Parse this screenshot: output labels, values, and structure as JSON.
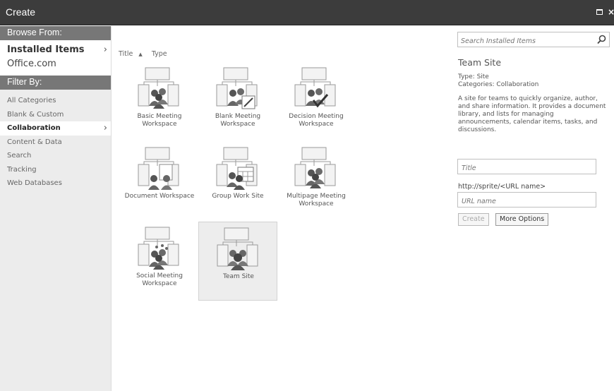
{
  "window": {
    "title": "Create"
  },
  "sidebar": {
    "browse_heading": "Browse From:",
    "browse_items": [
      {
        "label": "Installed Items",
        "selected": true
      },
      {
        "label": "Office.com",
        "selected": false
      }
    ],
    "filter_heading": "Filter By:",
    "filter_items": [
      {
        "label": "All Categories"
      },
      {
        "label": "Blank & Custom"
      },
      {
        "label": "Collaboration",
        "selected": true
      },
      {
        "label": "Content & Data"
      },
      {
        "label": "Search"
      },
      {
        "label": "Tracking"
      },
      {
        "label": "Web Databases"
      }
    ]
  },
  "sort": {
    "title_label": "Title",
    "sort_arrow": "▲",
    "type_label": "Type"
  },
  "templates": [
    {
      "label": "Basic Meeting Workspace",
      "icon": "meeting-people-icon"
    },
    {
      "label": "Blank Meeting Workspace",
      "icon": "meeting-pencil-icon"
    },
    {
      "label": "Decision Meeting Workspace",
      "icon": "meeting-check-icon"
    },
    {
      "label": "Document Workspace",
      "icon": "document-people-icon"
    },
    {
      "label": "Group Work Site",
      "icon": "group-calendar-icon"
    },
    {
      "label": "Multipage Meeting Workspace",
      "icon": "multipage-people-icon"
    },
    {
      "label": "Social Meeting Workspace",
      "icon": "social-people-icon"
    },
    {
      "label": "Team Site",
      "icon": "team-site-icon",
      "selected": true
    }
  ],
  "search": {
    "placeholder": "Search Installed Items"
  },
  "detail": {
    "title": "Team Site",
    "type_line": "Type: Site",
    "categories_line": "Categories: Collaboration",
    "description": "A site for teams to quickly organize, author, and share information. It provides a document library, and lists for managing announcements, calendar items, tasks, and discussions."
  },
  "form": {
    "title_placeholder": "Title",
    "url_prefix": "http://sprite/<URL name>",
    "url_placeholder": "URL name",
    "create_label": "Create",
    "more_options_label": "More Options"
  }
}
